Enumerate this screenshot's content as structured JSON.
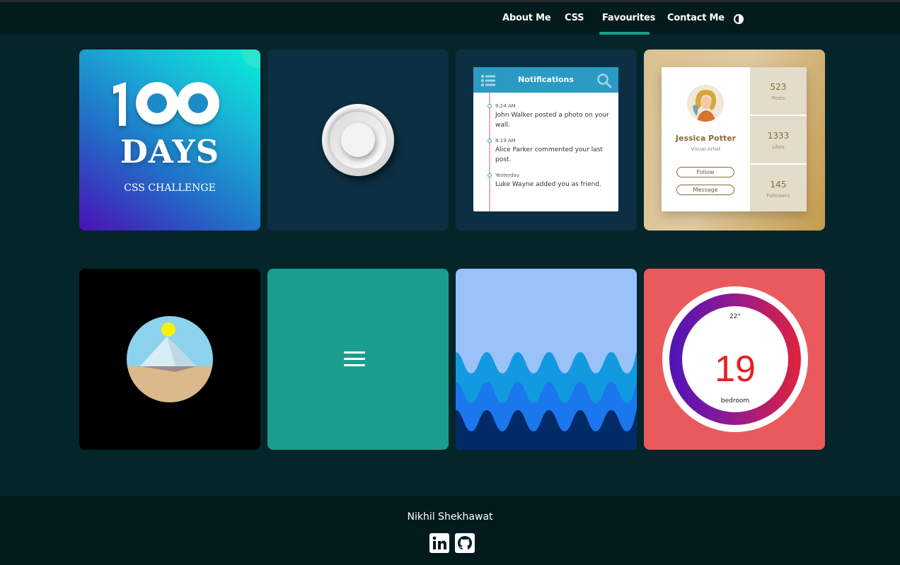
{
  "nav": {
    "items": [
      "About Me",
      "CSS",
      "Favourites",
      "Contact Me"
    ],
    "active": "Favourites",
    "theme_icon": "contrast-icon"
  },
  "cards": {
    "challenge": {
      "number": "100",
      "title": "DAYS",
      "subtitle": "CSS CHALLENGE"
    },
    "notifications": {
      "title": "Notifications",
      "menu_icon": "list-icon",
      "search_icon": "search-icon",
      "items": [
        {
          "time": "9:24 AM",
          "text": "John Walker posted a photo on your wall."
        },
        {
          "time": "8:19 AM",
          "text": "Alice Parker commented your last post."
        },
        {
          "time": "Yesterday",
          "text": "Luke Wayne added you as friend."
        }
      ]
    },
    "profile": {
      "name": "Jessica Potter",
      "role": "Visual Artist",
      "follow_label": "Follow",
      "message_label": "Message",
      "stats": [
        {
          "value": "523",
          "label": "Posts"
        },
        {
          "value": "1333",
          "label": "Likes"
        },
        {
          "value": "145",
          "label": "Followers"
        }
      ]
    },
    "menu": {
      "icon": "hamburger-icon"
    },
    "thermostat": {
      "setpoint": "22°",
      "temperature": "19",
      "room": "bedroom"
    }
  },
  "footer": {
    "name": "Nikhil Shekhawat",
    "social": [
      "linkedin-icon",
      "github-icon"
    ]
  },
  "colors": {
    "accent": "#1c9e8f",
    "page_bg": "#04262a",
    "nav_bg": "#031b1d"
  }
}
